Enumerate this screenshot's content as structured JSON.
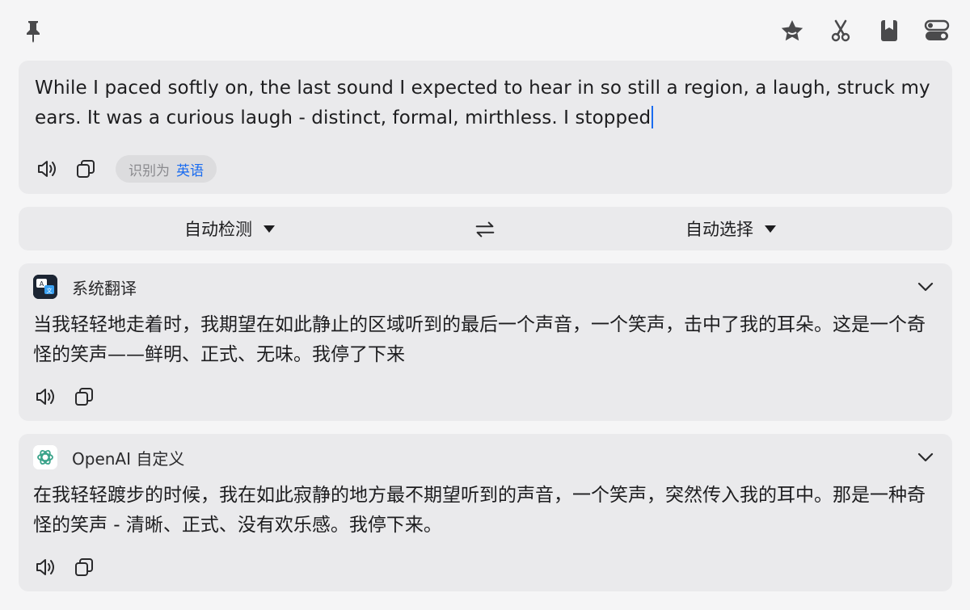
{
  "toolbar": {
    "icons": [
      "pin-icon",
      "star-icon",
      "scissors-icon",
      "bookmark-icon",
      "toggle-icon"
    ]
  },
  "source": {
    "text": "While I paced softly on, the last sound I expected to hear in so still a region, a laugh, struck my ears. It was a curious laugh - distinct, formal, mirthless. I stopped",
    "detected_prefix": "识别为",
    "detected_lang": "英语"
  },
  "lang_bar": {
    "from": "自动检测",
    "to": "自动选择"
  },
  "results": [
    {
      "service": "系统翻译",
      "text": "当我轻轻地走着时，我期望在如此静止的区域听到的最后一个声音，一个笑声，击中了我的耳朵。这是一个奇怪的笑声——鲜明、正式、无味。我停了下来"
    },
    {
      "service": "OpenAI 自定义",
      "text": "在我轻轻踱步的时候，我在如此寂静的地方最不期望听到的声音，一个笑声，突然传入我的耳中。那是一种奇怪的笑声 - 清晰、正式、没有欢乐感。我停下来。"
    }
  ],
  "colors": {
    "accent": "#1a6cf0",
    "card": "#eaeaec",
    "background": "#f5f5f6"
  }
}
